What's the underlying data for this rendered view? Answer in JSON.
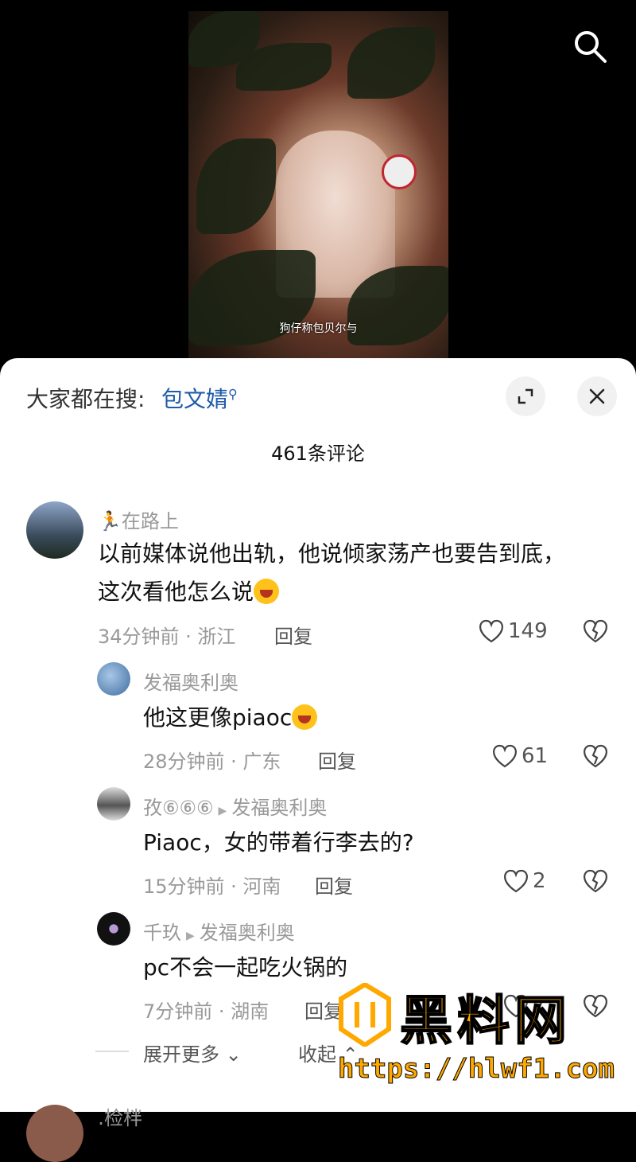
{
  "video": {
    "subtitle": "狗仔称包贝尔与"
  },
  "header": {
    "search_prefix": "大家都在搜:",
    "search_query": "包文婧",
    "query_icon": "search-icon"
  },
  "comments_count": "461条评论",
  "comments": [
    {
      "name": "🏃在路上",
      "text_line1": "以前媒体说他出轨，他说倾家荡产也要告到底，",
      "text_line2": "这次看他怎么说",
      "meta": "34分钟前 · 浙江",
      "reply": "回复",
      "likes": "149"
    },
    {
      "name": "发福奥利奥",
      "text": "他这更像piaoc",
      "meta": "28分钟前 · 广东",
      "reply": "回复",
      "likes": "61"
    },
    {
      "name": "孜⑥⑥⑥",
      "reply_to": "发福奥利奥",
      "text": "Piaoc，女的带着行李去的?",
      "meta": "15分钟前 · 河南",
      "reply": "回复",
      "likes": "2"
    },
    {
      "name": "千玖",
      "reply_to": "发福奥利奥",
      "text": "pc不会一起吃火锅的",
      "meta": "7分钟前 · 湖南",
      "reply": "回复",
      "likes": "7"
    }
  ],
  "expand_more": "展开更多",
  "collapse": "收起",
  "next_name": "․检柈",
  "watermark": {
    "title": "黑料网",
    "url": "https://hlwf1.com"
  },
  "colors": {
    "link": "#1f5ba8",
    "watermark": "#ffa800"
  }
}
